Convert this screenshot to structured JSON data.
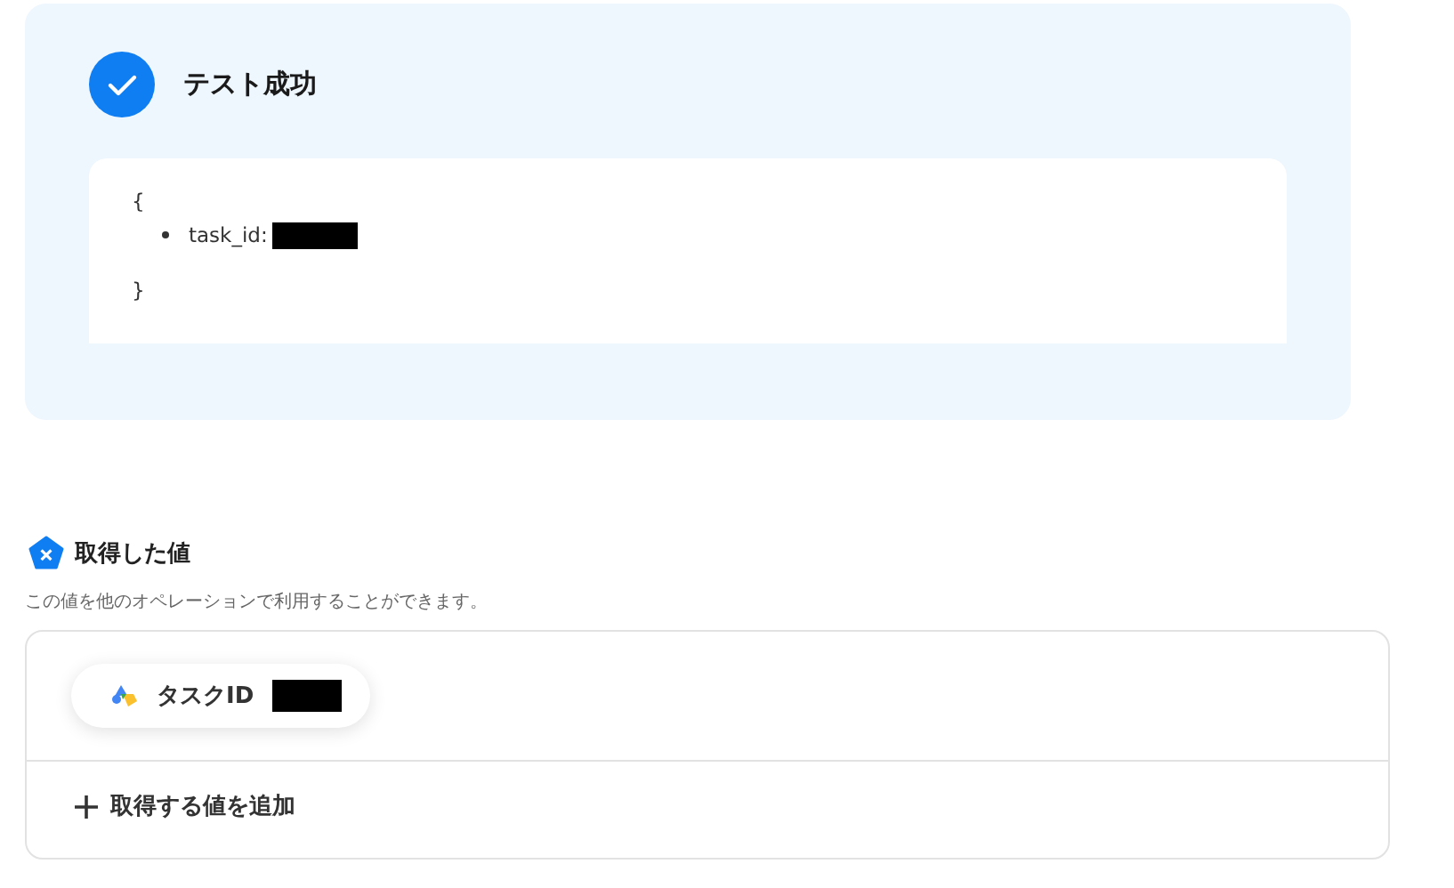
{
  "result": {
    "title": "テスト成功",
    "open_brace": "{",
    "items": [
      {
        "key": "task_id:"
      }
    ],
    "close_brace": "}"
  },
  "values": {
    "title": "取得した値",
    "description": "この値を他のオペレーションで利用することができます。",
    "fields": [
      {
        "label": "タスクID"
      }
    ],
    "add_button": "取得する値を追加"
  }
}
